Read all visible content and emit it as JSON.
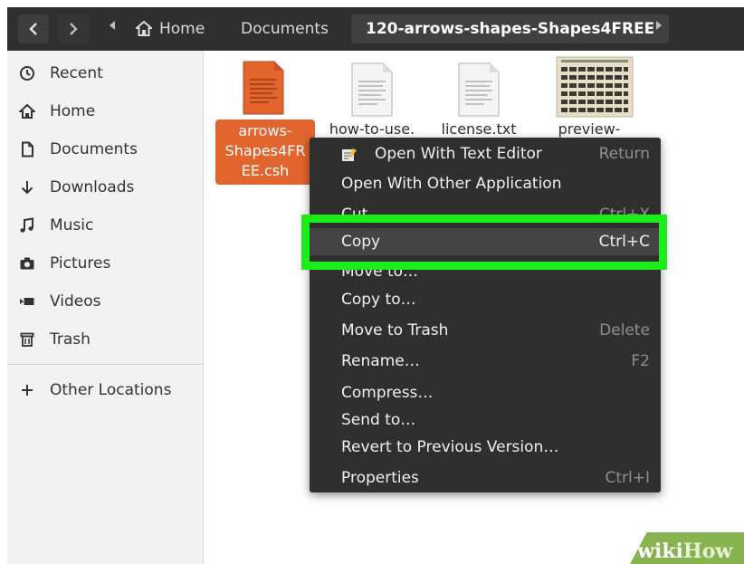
{
  "header": {
    "back_icon": "chevron-left-icon",
    "forward_icon": "chevron-right-icon",
    "breadcrumbs": [
      "Home",
      "Documents",
      "120-arrows-shapes-Shapes4FREE"
    ]
  },
  "sidebar": {
    "items": [
      {
        "label": "Recent",
        "icon": "clock-icon"
      },
      {
        "label": "Home",
        "icon": "home-icon"
      },
      {
        "label": "Documents",
        "icon": "document-icon"
      },
      {
        "label": "Downloads",
        "icon": "download-icon"
      },
      {
        "label": "Music",
        "icon": "music-icon"
      },
      {
        "label": "Pictures",
        "icon": "camera-icon"
      },
      {
        "label": "Videos",
        "icon": "video-icon"
      },
      {
        "label": "Trash",
        "icon": "trash-icon"
      }
    ],
    "other_locations": "Other Locations"
  },
  "files": [
    {
      "name": "arrows-Shapes4FREE.csh",
      "line1": "arrows-",
      "line2": "Shapes4FR",
      "line3": "EE.csh",
      "selected": true
    },
    {
      "name": "how-to-use.",
      "selected": false
    },
    {
      "name": "license.txt",
      "selected": false
    },
    {
      "name": "preview-",
      "selected": false
    }
  ],
  "context_menu": {
    "items": [
      {
        "label": "Open With Text Editor",
        "shortcut": "Return"
      },
      {
        "label": "Open With Other Application",
        "shortcut": ""
      },
      {
        "label": "Cut",
        "shortcut": "Ctrl+X"
      },
      {
        "label": "Copy",
        "shortcut": "Ctrl+C"
      },
      {
        "label": "Move to…",
        "shortcut": ""
      },
      {
        "label": "Copy to…",
        "shortcut": ""
      },
      {
        "label": "Move to Trash",
        "shortcut": "Delete"
      },
      {
        "label": "Rename…",
        "shortcut": "F2"
      },
      {
        "label": "Compress…",
        "shortcut": ""
      },
      {
        "label": "Send to…",
        "shortcut": ""
      },
      {
        "label": "Revert to Previous Version…",
        "shortcut": ""
      },
      {
        "label": "Properties",
        "shortcut": "Ctrl+I"
      }
    ]
  },
  "watermark": {
    "part1": "wiki",
    "part2": "How"
  },
  "colors": {
    "selection": "#e2652e",
    "highlight_box": "#19ee19",
    "menu_bg": "#2f2f2f",
    "header_bg": "#2f2f2f"
  }
}
